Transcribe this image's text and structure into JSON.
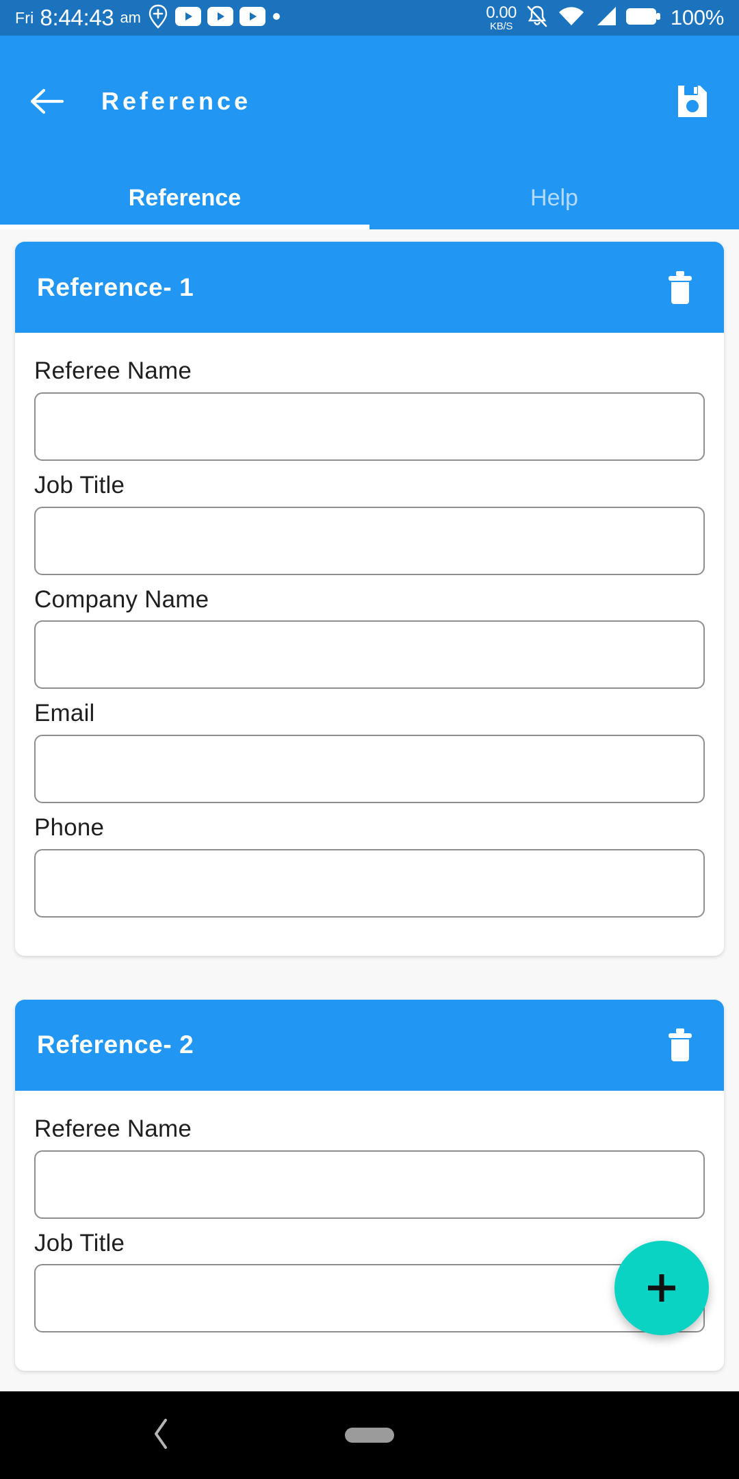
{
  "status_bar": {
    "day": "Fri",
    "time": "8:44:43",
    "ampm": "am",
    "net_speed": "0.00",
    "net_unit": "KB/S",
    "battery": "100%",
    "icons": [
      "location-add-icon",
      "play-icon",
      "play-icon",
      "play-icon",
      "dot-icon",
      "bell-muted-icon",
      "wifi-icon",
      "signal-icon",
      "battery-icon"
    ],
    "bg_color": "#1b72bd"
  },
  "app_bar": {
    "title": "Reference",
    "back_label": "back-arrow-icon",
    "save_label": "save-icon",
    "bg_color": "#2196f3"
  },
  "tabs": [
    {
      "label": "Reference",
      "active": true
    },
    {
      "label": "Help",
      "active": false
    }
  ],
  "cards": [
    {
      "title": "Reference- 1",
      "delete_label": "delete-icon",
      "fields": [
        {
          "label": "Referee Name",
          "value": "",
          "placeholder": ""
        },
        {
          "label": "Job Title",
          "value": "",
          "placeholder": ""
        },
        {
          "label": "Company Name",
          "value": "",
          "placeholder": ""
        },
        {
          "label": "Email",
          "value": "",
          "placeholder": ""
        },
        {
          "label": "Phone",
          "value": "",
          "placeholder": ""
        }
      ]
    },
    {
      "title": "Reference- 2",
      "delete_label": "delete-icon",
      "fields": [
        {
          "label": "Referee Name",
          "value": "",
          "placeholder": ""
        },
        {
          "label": "Job Title",
          "value": "",
          "placeholder": ""
        }
      ]
    }
  ],
  "fab": {
    "label": "+",
    "color": "#0ad3c4",
    "name": "add-reference-button"
  },
  "nav_bar": {
    "back": "nav-back-icon",
    "home": "nav-home-indicator",
    "bg_color": "#000000"
  },
  "theme": {
    "primary": "#2196f3",
    "status": "#1b72bd",
    "accent": "#0ad3c4",
    "page_bg": "#f8f8f8",
    "border": "#8d8d8d"
  }
}
